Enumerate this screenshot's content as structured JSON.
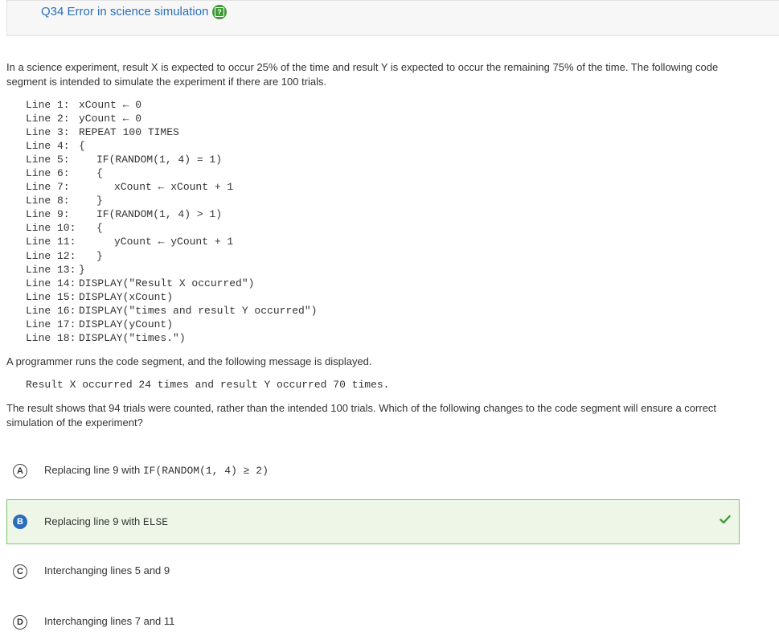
{
  "header": {
    "title": "Q34 Error in science simulation",
    "help_icon": "help-question-icon",
    "accent": "#2a6ebb",
    "help_color": "#3d9b35"
  },
  "prompt": "In a science experiment, result X is expected to occur 25% of the time and result Y is expected to occur the remaining 75% of the time. The following code segment is intended to simulate the experiment if there are 100 trials.",
  "code_lines": [
    {
      "num": "Line 1:",
      "code": "xCount ← 0",
      "indent": 0
    },
    {
      "num": "Line 2:",
      "code": "yCount ← 0",
      "indent": 0
    },
    {
      "num": "Line 3:",
      "code": "REPEAT 100 TIMES",
      "indent": 0
    },
    {
      "num": "Line 4:",
      "code": "{",
      "indent": 0
    },
    {
      "num": "Line 5:",
      "code": "IF(RANDOM(1, 4) = 1)",
      "indent": 1
    },
    {
      "num": "Line 6:",
      "code": "{",
      "indent": 1
    },
    {
      "num": "Line 7:",
      "code": "xCount ← xCount + 1",
      "indent": 2
    },
    {
      "num": "Line 8:",
      "code": "}",
      "indent": 1
    },
    {
      "num": "Line 9:",
      "code": "IF(RANDOM(1, 4) > 1)",
      "indent": 1
    },
    {
      "num": "Line 10:",
      "code": "{",
      "indent": 1
    },
    {
      "num": "Line 11:",
      "code": "yCount ← yCount + 1",
      "indent": 2
    },
    {
      "num": "Line 12:",
      "code": "}",
      "indent": 1
    },
    {
      "num": "Line 13:",
      "code": "}",
      "indent": 0
    },
    {
      "num": "Line 14:",
      "code": "DISPLAY(\"Result X occurred\")",
      "indent": 0
    },
    {
      "num": "Line 15:",
      "code": "DISPLAY(xCount)",
      "indent": 0
    },
    {
      "num": "Line 16:",
      "code": "DISPLAY(\"times and result Y occurred\")",
      "indent": 0
    },
    {
      "num": "Line 17:",
      "code": "DISPLAY(yCount)",
      "indent": 0
    },
    {
      "num": "Line 18:",
      "code": "DISPLAY(\"times.\")",
      "indent": 0
    }
  ],
  "message_intro": "A programmer runs the code segment, and the following message is displayed.",
  "message_output": "Result X occurred 24 times and result Y occurred 70 times.",
  "result_text": "The result shows that 94 trials were counted, rather than the intended 100 trials. Which of the following changes to the code segment will ensure a correct simulation of the experiment?",
  "choices": [
    {
      "letter": "A",
      "text": "Replacing line 9 with ",
      "code": "IF(RANDOM(1, 4) ≥ 2)",
      "correct": false
    },
    {
      "letter": "B",
      "text": "Replacing line 9 with ",
      "code": "ELSE",
      "correct": true
    },
    {
      "letter": "C",
      "text": "Interchanging lines 5 and 9",
      "code": "",
      "correct": false
    },
    {
      "letter": "D",
      "text": "Interchanging lines 7 and 11",
      "code": "",
      "correct": false
    }
  ],
  "correct_icon": "checkmark-icon",
  "correct_color": "#3d9b35"
}
